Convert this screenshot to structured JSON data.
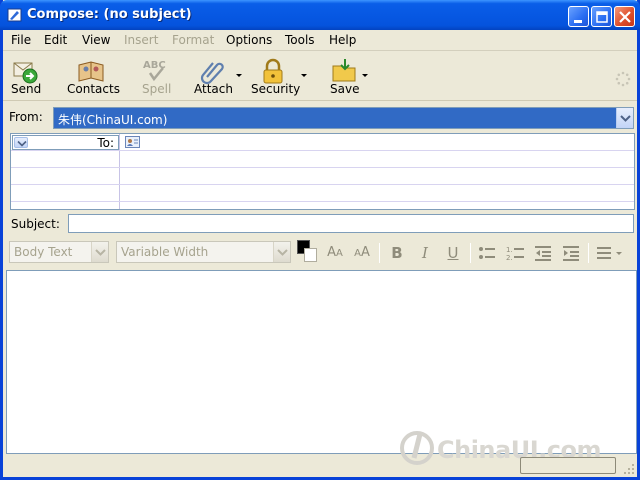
{
  "window": {
    "title": "Compose: (no subject)",
    "accent": "#0a5ee8"
  },
  "menu": {
    "items": [
      {
        "label": "File",
        "enabled": true
      },
      {
        "label": "Edit",
        "enabled": true
      },
      {
        "label": "View",
        "enabled": true
      },
      {
        "label": "Insert",
        "enabled": false
      },
      {
        "label": "Format",
        "enabled": false
      },
      {
        "label": "Options",
        "enabled": true
      },
      {
        "label": "Tools",
        "enabled": true
      },
      {
        "label": "Help",
        "enabled": true
      }
    ]
  },
  "toolbar": {
    "send": {
      "label": "Send",
      "icon": "send-icon"
    },
    "contacts": {
      "label": "Contacts",
      "icon": "contacts-book-icon"
    },
    "spell": {
      "label": "Spell",
      "icon": "spellcheck-icon",
      "enabled": false
    },
    "attach": {
      "label": "Attach",
      "icon": "paperclip-icon"
    },
    "security": {
      "label": "Security",
      "icon": "padlock-icon"
    },
    "save": {
      "label": "Save",
      "icon": "folder-save-icon"
    }
  },
  "from": {
    "label": "From:",
    "value": "朱伟(ChinaUI.com)"
  },
  "address": {
    "type_label": "To:",
    "rows": 4
  },
  "subject": {
    "label": "Subject:",
    "value": ""
  },
  "format": {
    "paragraph_style": "Body Text",
    "font": "Variable Width",
    "text_color": "#000000",
    "bold": "B",
    "italic": "I",
    "underline": "U"
  },
  "watermark": {
    "text": "ChinaUI.com"
  }
}
